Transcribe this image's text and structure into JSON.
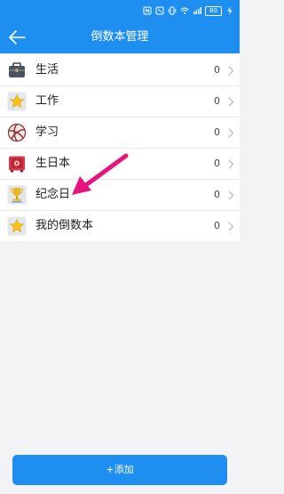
{
  "status_bar": {
    "battery": "80"
  },
  "header": {
    "title": "倒数本管理"
  },
  "books": [
    {
      "label": "生活",
      "count": "0",
      "icon": "briefcase-icon"
    },
    {
      "label": "工作",
      "count": "0",
      "icon": "star-icon"
    },
    {
      "label": "学习",
      "count": "0",
      "icon": "volleyball-icon"
    },
    {
      "label": "生日本",
      "count": "0",
      "icon": "safe-box-icon"
    },
    {
      "label": "纪念日",
      "count": "0",
      "icon": "trophy-icon"
    },
    {
      "label": "我的倒数本",
      "count": "0",
      "icon": "star-icon"
    }
  ],
  "footer": {
    "add_label": "+添加"
  },
  "colors": {
    "accent": "#1f8ef1",
    "annotation_arrow": "#e8137c",
    "background": "#f2f3f5"
  }
}
